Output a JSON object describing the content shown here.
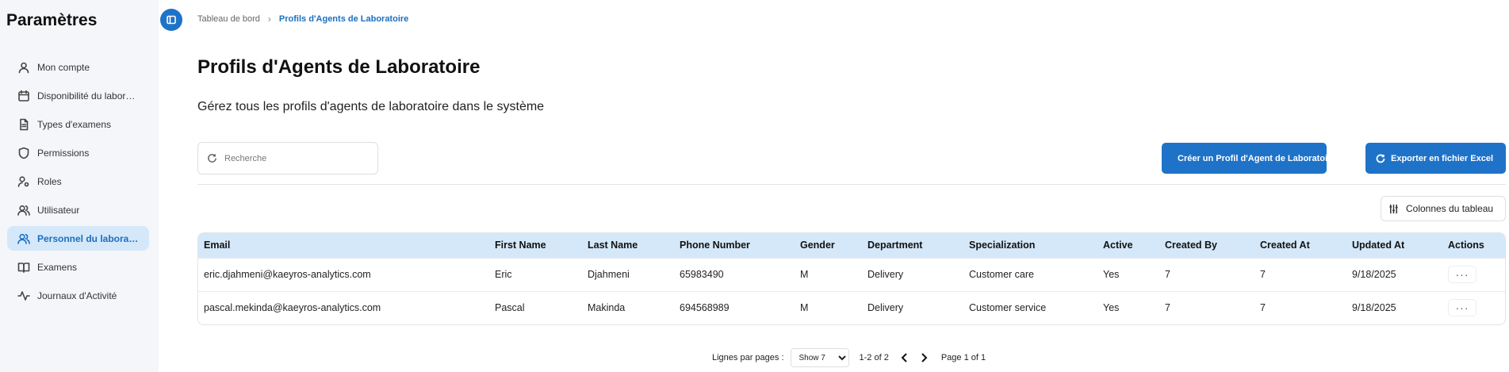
{
  "sidebar": {
    "title": "Paramètres",
    "items": [
      {
        "label": "Mon compte",
        "icon": "user-icon"
      },
      {
        "label": "Disponibilité du laboratoire",
        "icon": "calendar-icon"
      },
      {
        "label": "Types d'examens",
        "icon": "document-icon"
      },
      {
        "label": "Permissions",
        "icon": "shield-icon"
      },
      {
        "label": "Roles",
        "icon": "user-key-icon"
      },
      {
        "label": "Utilisateur",
        "icon": "users-icon"
      },
      {
        "label": "Personnel du laboratoire",
        "icon": "users-icon",
        "active": true
      },
      {
        "label": "Examens",
        "icon": "book-icon"
      },
      {
        "label": "Journaux d'Activité",
        "icon": "activity-icon"
      }
    ]
  },
  "breadcrumb": {
    "home": "Tableau de bord",
    "current": "Profils d'Agents de Laboratoire"
  },
  "page": {
    "title": "Profils d'Agents de Laboratoire",
    "subtitle": "Gérez tous les profils d'agents de laboratoire dans le système"
  },
  "search": {
    "placeholder": "Recherche",
    "value": ""
  },
  "toolbar": {
    "create_label": "Créer un Profil d'Agent de Laboratoire",
    "export_label": "Exporter en fichier Excel",
    "columns_label": "Colonnes du tableau"
  },
  "table": {
    "headers": [
      "Email",
      "First Name",
      "Last Name",
      "Phone Number",
      "Gender",
      "Department",
      "Specialization",
      "Active",
      "Created By",
      "Created At",
      "Updated At",
      "Actions"
    ],
    "rows": [
      [
        "eric.djahmeni@kaeyros-analytics.com",
        "Eric",
        "Djahmeni",
        "65983490",
        "M",
        "Delivery",
        "Customer care",
        "Yes",
        "7",
        "7",
        "9/18/2025"
      ],
      [
        "pascal.mekinda@kaeyros-analytics.com",
        "Pascal",
        "Makinda",
        "694568989",
        "M",
        "Delivery",
        "Customer service",
        "Yes",
        "7",
        "7",
        "9/18/2025"
      ]
    ],
    "actions_glyph": "···"
  },
  "pagination": {
    "rows_label": "Lignes par pages :",
    "rows_selected": "Show 7",
    "range": "1-2 of 2",
    "page_label": "Page 1 of 1"
  },
  "colors": {
    "accent": "#1e73c8",
    "active_bg": "#d5e8f9",
    "sidebar_bg": "#f4f6f9"
  }
}
